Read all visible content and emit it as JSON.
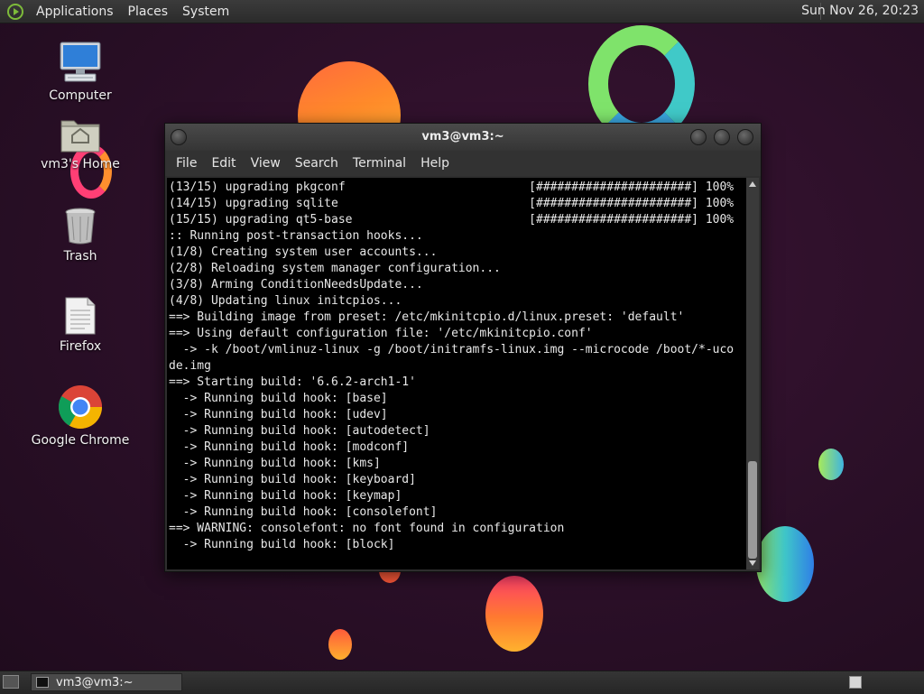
{
  "top_panel": {
    "menus": [
      "Applications",
      "Places",
      "System"
    ],
    "clock": "Sun Nov 26, 20:23"
  },
  "desktop_icons": [
    {
      "label": "Computer",
      "icon": "computer-icon"
    },
    {
      "label": "vm3's Home",
      "icon": "home-folder-icon"
    },
    {
      "label": "Trash",
      "icon": "trash-icon"
    },
    {
      "label": "Firefox",
      "icon": "document-icon"
    },
    {
      "label": "Google Chrome",
      "icon": "chrome-icon"
    }
  ],
  "terminal": {
    "title": "vm3@vm3:~",
    "menus": [
      "File",
      "Edit",
      "View",
      "Search",
      "Terminal",
      "Help"
    ],
    "output": "(13/15) upgrading pkgconf                          [######################] 100%\n(14/15) upgrading sqlite                           [######################] 100%\n(15/15) upgrading qt5-base                         [######################] 100%\n:: Running post-transaction hooks...\n(1/8) Creating system user accounts...\n(2/8) Reloading system manager configuration...\n(3/8) Arming ConditionNeedsUpdate...\n(4/8) Updating linux initcpios...\n==> Building image from preset: /etc/mkinitcpio.d/linux.preset: 'default'\n==> Using default configuration file: '/etc/mkinitcpio.conf'\n  -> -k /boot/vmlinuz-linux -g /boot/initramfs-linux.img --microcode /boot/*-uco\nde.img\n==> Starting build: '6.6.2-arch1-1'\n  -> Running build hook: [base]\n  -> Running build hook: [udev]\n  -> Running build hook: [autodetect]\n  -> Running build hook: [modconf]\n  -> Running build hook: [kms]\n  -> Running build hook: [keyboard]\n  -> Running build hook: [keymap]\n  -> Running build hook: [consolefont]\n==> WARNING: consolefont: no font found in configuration\n  -> Running build hook: [block]"
  },
  "bottom_panel": {
    "task_label": "vm3@vm3:~"
  }
}
